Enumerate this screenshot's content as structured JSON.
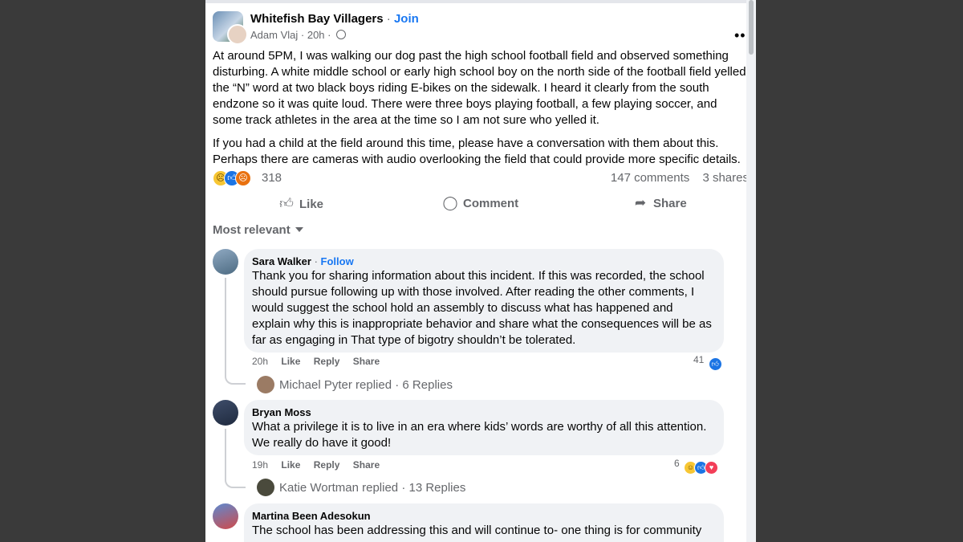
{
  "post": {
    "group_name": "Whitefish Bay Villagers",
    "separator": "·",
    "join_label": "Join",
    "author": "Adam Vlaj",
    "time": "20h",
    "more_label": "•••",
    "paragraphs": [
      "At around 5PM, I was walking our dog past the high school football field and observed something disturbing. A white middle school or early high school boy on the north side of the football field yelled the “N” word at two black boys riding E-bikes on the sidewalk. I heard it clearly from the south endzone so it was quite loud. There were three boys playing football, a few playing soccer, and some track athletes in the area at the time so I am not sure who yelled it.",
      "If you had a child at the field around this time, please have a conversation with them about this. Perhaps there are cameras with audio overlooking the field that could provide more specific details."
    ],
    "reaction_count": "318",
    "comments_count": "147 comments",
    "shares_count": "3 shares",
    "reaction_icons": [
      "sad-icon",
      "like-icon",
      "angry-icon"
    ]
  },
  "actions": {
    "like": "Like",
    "comment": "Comment",
    "share": "Share"
  },
  "sort_label": "Most relevant",
  "comments": [
    {
      "author": "Sara Walker",
      "follow_label": "Follow",
      "text": "Thank you for sharing information about this incident. If this was recorded, the school should pursue following up with those involved. After reading the other comments, I would suggest the school hold an assembly to discuss what has happened and explain why this is inappropriate behavior and share what the consequences will be as far as engaging in That type of bigotry shouldn’t be tolerated.",
      "time": "20h",
      "like": "Like",
      "reply": "Reply",
      "share": "Share",
      "reaction_count": "41",
      "replies": {
        "name": "Michael Pyter",
        "replied": "replied",
        "count": "6 Replies"
      }
    },
    {
      "author": "Bryan Moss",
      "text": "What a privilege it is to live in an era where kids’ words are worthy of all this attention. We really do have it good!",
      "time": "19h",
      "like": "Like",
      "reply": "Reply",
      "share": "Share",
      "reaction_count": "6",
      "replies": {
        "name": "Katie Wortman",
        "replied": "replied",
        "count": "13 Replies"
      }
    },
    {
      "author": "Martina Been Adesokun",
      "text": "The school has been addressing this and will continue to- one thing is for community"
    }
  ],
  "colors": {
    "accent": "#1877f2",
    "bubble": "#f0f2f5",
    "muted_text": "#65676b",
    "backdrop": "#3a3a3a"
  }
}
